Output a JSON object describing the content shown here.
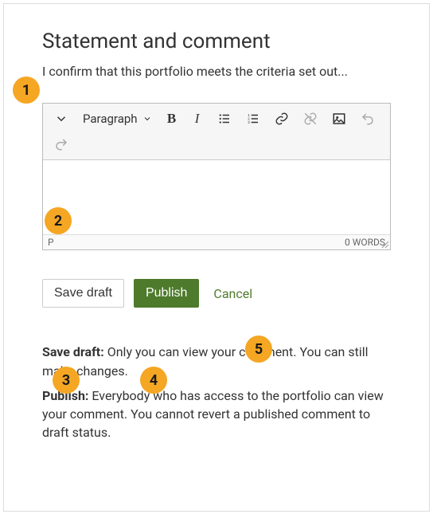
{
  "heading": "Statement and comment",
  "intro": "I confirm that this portfolio meets the criteria set out...",
  "callouts": {
    "c1": "1",
    "c2": "2",
    "c3": "3",
    "c4": "4",
    "c5": "5"
  },
  "editor": {
    "format_label": "Paragraph",
    "path": "P",
    "word_count": "0 WORDS"
  },
  "buttons": {
    "save_draft": "Save draft",
    "publish": "Publish",
    "cancel": "Cancel"
  },
  "help": {
    "save_term": "Save draft:",
    "save_text": " Only you can view your comment. You can still make changes.",
    "publish_term": "Publish:",
    "publish_text": " Everybody who has access to the portfolio can view your comment. You cannot revert a published comment to draft status."
  }
}
